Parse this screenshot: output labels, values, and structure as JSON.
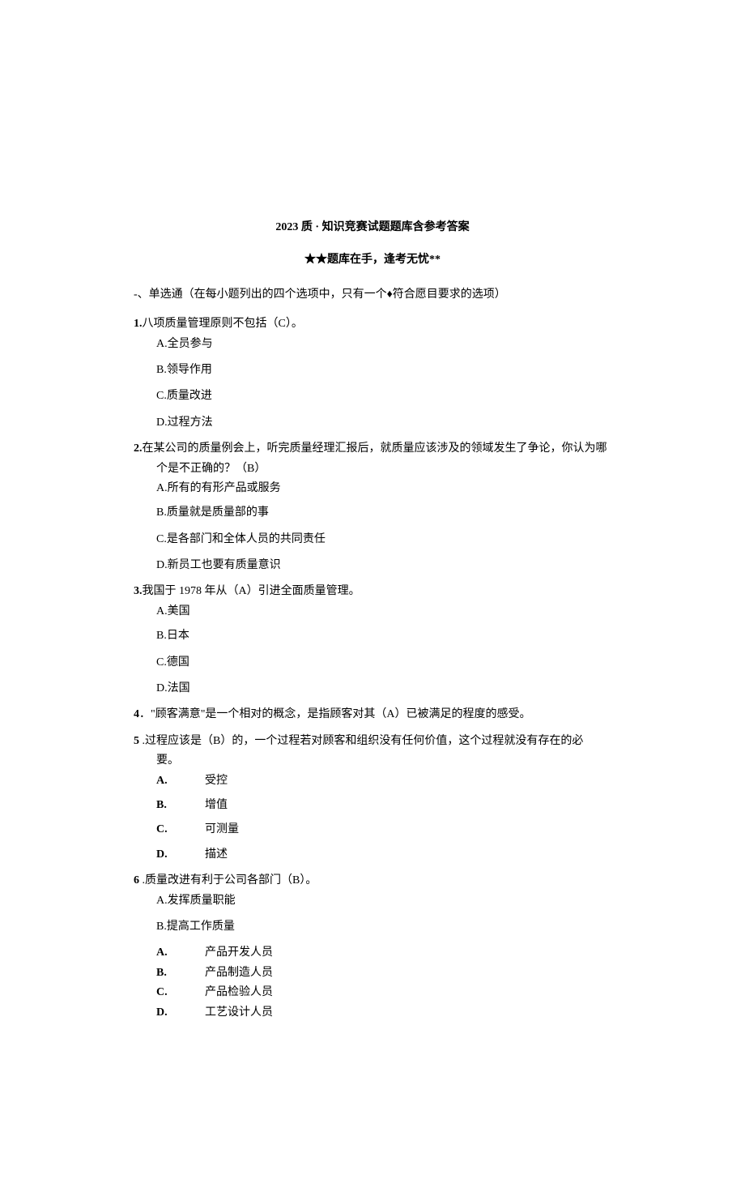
{
  "title": "2023 质 · 知识竞赛试题题库含参考答案",
  "subtitle": "★★题库在手，逢考无忧**",
  "section_header": "-、单选通（在每小题列出的四个选项中，只有一个♦符合愿目要求的选项）",
  "q1": {
    "num": "1.",
    "text": "八项质量管理原则不包括（C）。",
    "a": "A.全员参与",
    "b": "B.领导作用",
    "c": "C.质量改进",
    "d": "D.过程方法"
  },
  "q2": {
    "num": "2.",
    "text": "在某公司的质量例会上，听完质量经理汇报后，就质量应该涉及的领域发生了争论，你认为哪",
    "text2": "个是不正确的？（B）",
    "a": "A.所有的有形产品或服务",
    "b": "B.质量就是质量部的事",
    "c": "C.是各部门和全体人员的共同责任",
    "d": "D.新员工也要有质量意识"
  },
  "q3": {
    "num": "3.",
    "text": "我国于 1978 年从（A）引进全面质量管理。",
    "a": "A.美国",
    "b": "B.日本",
    "c": "C.德国",
    "d": "D.法国"
  },
  "q4": {
    "num": "4",
    "text": "．\"顾客满意\"是一个相对的概念，是指顾客对其（A）已被满足的程度的感受。"
  },
  "q5": {
    "num": "5",
    "text": " .过程应该是（B）的，一个过程若对顾客和组织没有任何价值，这个过程就没有存在的必",
    "text2": "要。",
    "a_label": "A.",
    "a": "受控",
    "b_label": "B.",
    "b": "增值",
    "c_label": "C.",
    "c": "可测量",
    "d_label": "D.",
    "d": "描述"
  },
  "q6": {
    "num": "6",
    "text": " .质量改进有利于公司各部门（B）。",
    "a": "A.发挥质量职能",
    "b": "B.提高工作质量",
    "extra_a_label": "A.",
    "extra_a": "产品开发人员",
    "extra_b_label": "B.",
    "extra_b": "产品制造人员",
    "extra_c_label": "C.",
    "extra_c": "产品检验人员",
    "extra_d_label": "D.",
    "extra_d": "工艺设计人员"
  }
}
